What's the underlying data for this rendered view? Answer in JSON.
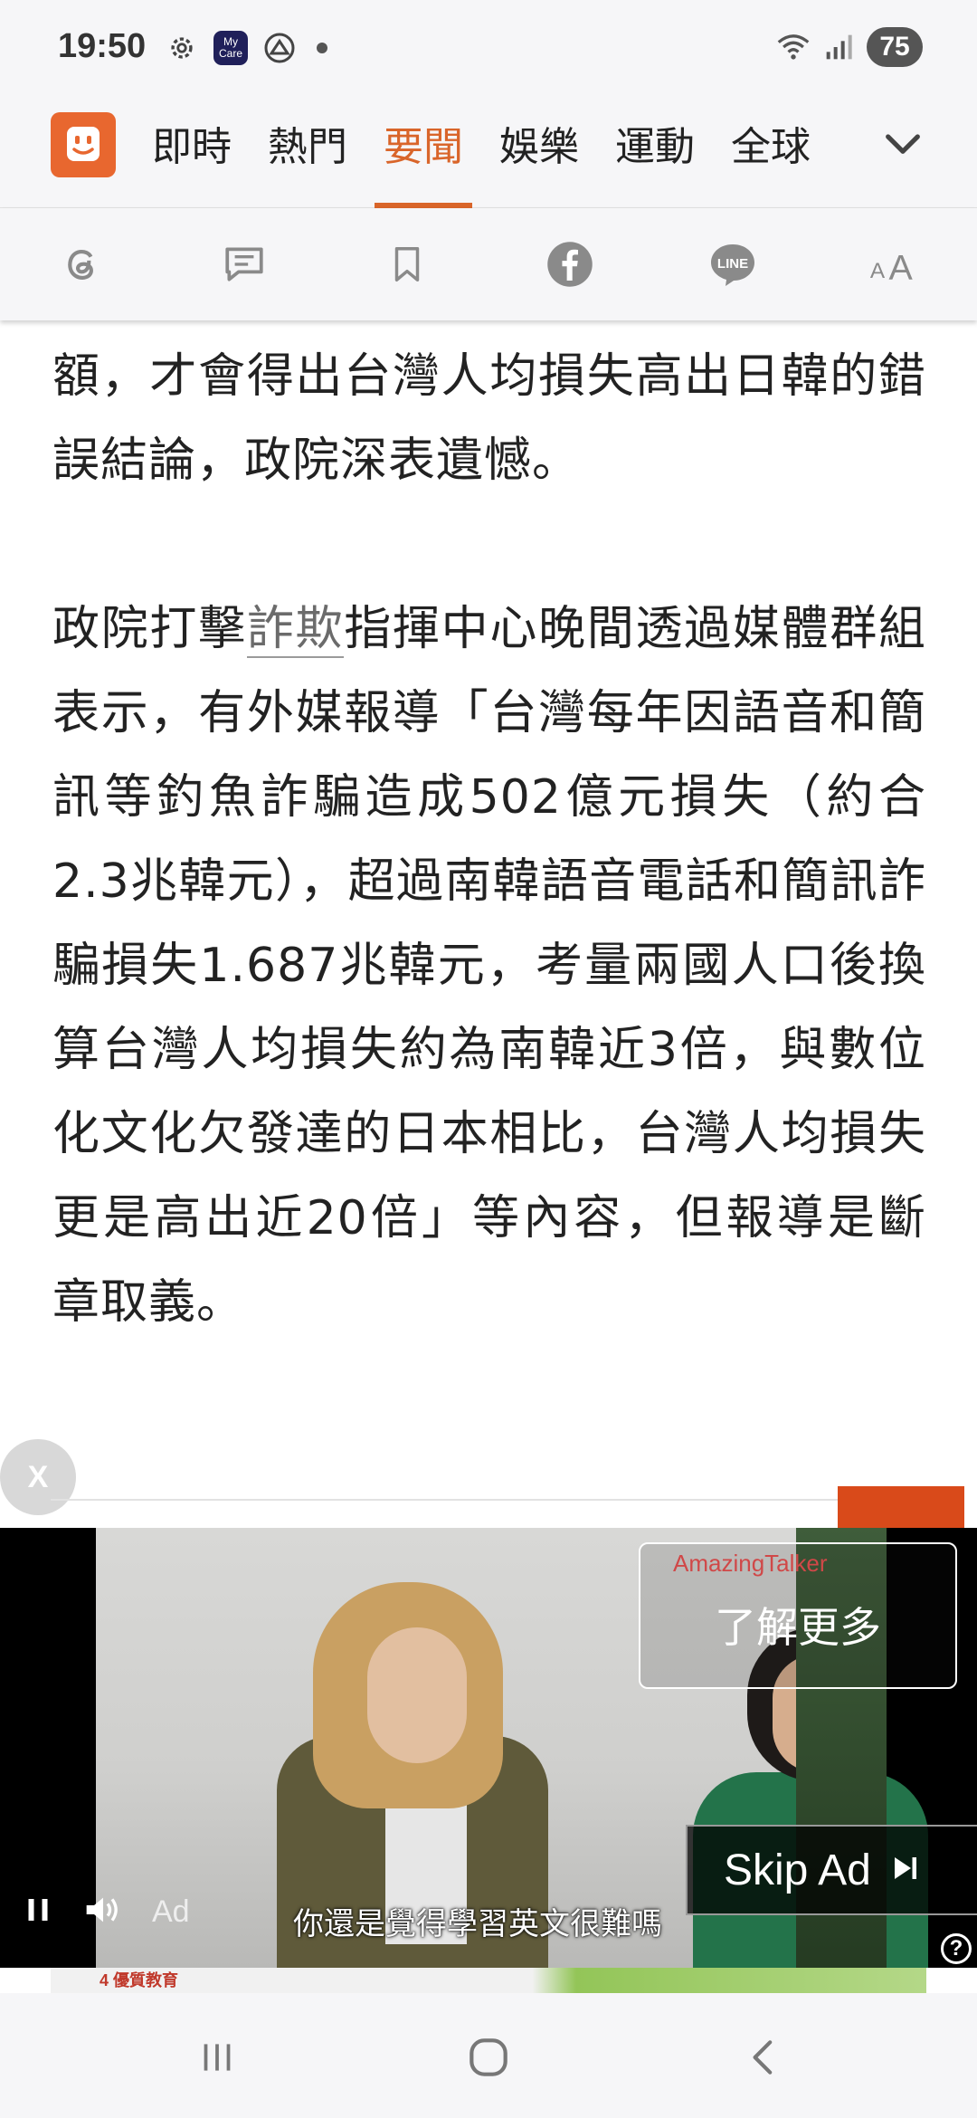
{
  "status_bar": {
    "time": "19:50",
    "app_badge_text": "My Care",
    "battery": "75",
    "icons": [
      "gear-icon",
      "app-badge-icon",
      "cloud-icon",
      "dot-icon",
      "wifi-icon",
      "signal-icon",
      "battery-icon"
    ]
  },
  "nav": {
    "logo_icon": "toaster-logo-icon",
    "tabs": [
      "即時",
      "熱門",
      "要聞",
      "娛樂",
      "運動",
      "全球"
    ],
    "active_tab": "要聞",
    "expand_icon": "chevron-down-icon"
  },
  "toolbar": {
    "icons": [
      "threads-icon",
      "comment-icon",
      "bookmark-icon",
      "facebook-icon",
      "line-icon",
      "font-size-icon"
    ],
    "line_label": "LINE",
    "font_label": "AA"
  },
  "article": {
    "paragraph1": "額，才會得出台灣人均損失高出日韓的錯誤結論，政院深表遺憾。",
    "p2_before": "政院打擊",
    "p2_keyword": "詐欺",
    "p2_after": "指揮中心晚間透過媒體群組表示，有外媒報導「台灣每年因語音和簡訊等釣魚詐騙造成502億元損失（約合2.3兆韓元），超過南韓語音電話和簡訊詐騙損失1.687兆韓元，考量兩國人口後換算台灣人均損失約為南韓近3倍，與數位化文化欠發達的日本相比，台灣人均損失更是高出近20倍」等內容，但報導是斷章取義。"
  },
  "ad": {
    "close_label": "X",
    "brand": "AmazingTalker",
    "learn_more": "了解更多",
    "skip_label": "Skip Ad",
    "ad_label": "Ad",
    "subtitle": "你還是覺得學習英文很難嗎",
    "help_label": "?",
    "below_tag": "4 優質教育",
    "colors": {
      "brand": "#d04848",
      "skip_bg": "#000000"
    }
  },
  "system_nav": {
    "icons": [
      "recent-apps-icon",
      "home-icon",
      "back-icon"
    ]
  },
  "theme": {
    "accent": "#d9652a",
    "logo_bg": "#e8672f",
    "text": "#222222"
  }
}
